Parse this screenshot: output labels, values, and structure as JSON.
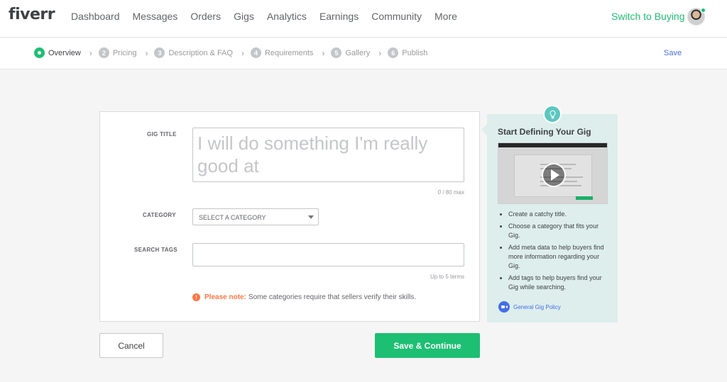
{
  "brand": {
    "logo": "fiverr",
    "accent": "#1dbf73",
    "link": "#446ee7",
    "warning": "#ff7640"
  },
  "nav": {
    "items": [
      {
        "label": "Dashboard"
      },
      {
        "label": "Messages"
      },
      {
        "label": "Orders"
      },
      {
        "label": "Gigs"
      },
      {
        "label": "Analytics"
      },
      {
        "label": "Earnings"
      },
      {
        "label": "Community"
      },
      {
        "label": "More"
      }
    ],
    "switch_label": "Switch to Buying"
  },
  "steps": {
    "items": [
      {
        "label": "Overview",
        "number": "",
        "active": true
      },
      {
        "label": "Pricing",
        "number": "2"
      },
      {
        "label": "Description & FAQ",
        "number": "3"
      },
      {
        "label": "Requirements",
        "number": "4"
      },
      {
        "label": "Gallery",
        "number": "5"
      },
      {
        "label": "Publish",
        "number": "6"
      }
    ],
    "save_label": "Save"
  },
  "form": {
    "title_label": "GIG TITLE",
    "title_placeholder": "I will do something I'm really good at",
    "title_count": "0",
    "title_max": "/ 80 max",
    "category_label": "CATEGORY",
    "category_value": "SELECT A CATEGORY",
    "tags_label": "SEARCH TAGS",
    "tags_value": "",
    "tags_hint": "Up to 5 terms",
    "note_icon": "!",
    "note_strong": "Please note:",
    "note_text": "Some categories require that sellers verify their skills."
  },
  "buttons": {
    "cancel": "Cancel",
    "save_continue": "Save & Continue"
  },
  "panel": {
    "title": "Start Defining Your Gig",
    "tips": [
      "Create a catchy title.",
      "Choose a category that fits your Gig.",
      "Add meta data to help buyers find more information regarding your Gig.",
      "Add tags to help buyers find your Gig while searching."
    ],
    "policy_link": "General Gig Policy"
  }
}
